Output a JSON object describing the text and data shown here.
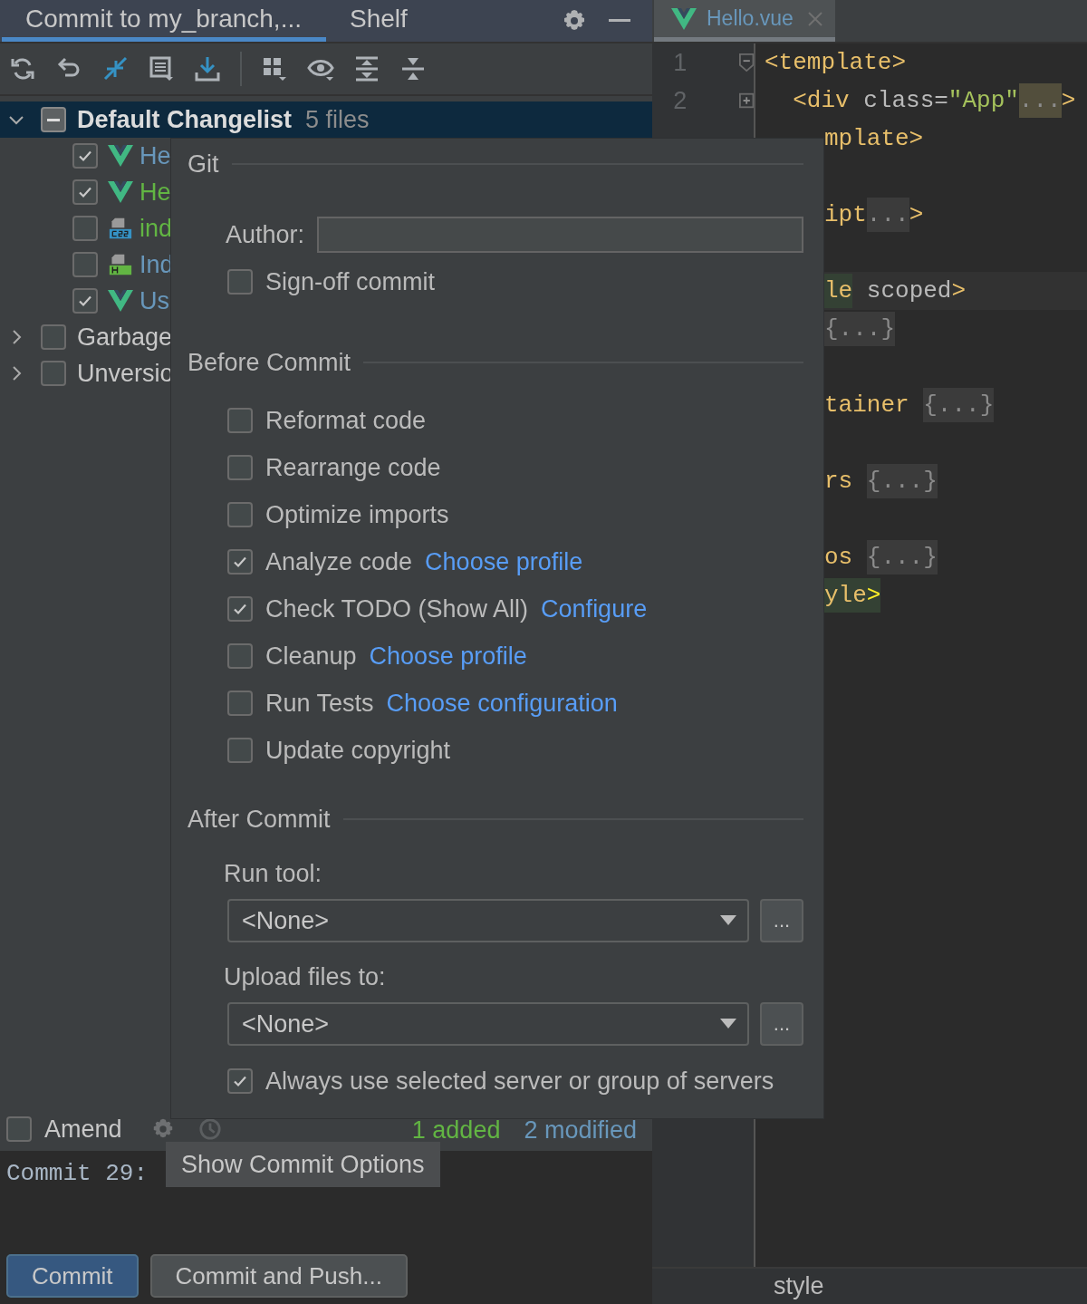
{
  "tool_window": {
    "tabs": [
      {
        "label": "Commit to my_branch,...",
        "selected": true
      },
      {
        "label": "Shelf",
        "selected": false
      }
    ]
  },
  "changes_tree": {
    "changelist": {
      "name": "Default Changelist",
      "count": "5 files",
      "expanded": true,
      "selected": true,
      "mixed": true,
      "files": [
        {
          "name": "He",
          "kind": "vue",
          "color": "#6897bb",
          "checked": true
        },
        {
          "name": "He",
          "kind": "vue",
          "color": "#62b543",
          "checked": true
        },
        {
          "name": "ind",
          "kind": "css",
          "color": "#62b543",
          "checked": false
        },
        {
          "name": "Ind",
          "kind": "html",
          "color": "#6897bb",
          "checked": false
        },
        {
          "name": "Us",
          "kind": "vue",
          "color": "#6897bb",
          "checked": true
        }
      ]
    },
    "groups": [
      {
        "name": "Garbage",
        "expanded": false,
        "checked": false
      },
      {
        "name": "Unversio",
        "expanded": false,
        "checked": false
      }
    ]
  },
  "commit_bar": {
    "amend": {
      "label": "Amend",
      "checked": false
    },
    "added": "1 added",
    "modified": "2 modified"
  },
  "message": "Commit 29:",
  "buttons": [
    {
      "label": "Commit",
      "kind": "primary"
    },
    {
      "label": "Commit and Push...",
      "kind": "secondary"
    }
  ],
  "editor": {
    "tab": {
      "label": "Hello.vue",
      "selected": true
    },
    "lines": [
      {
        "kind": "code",
        "number": "1",
        "folded": false,
        "segments": [
          {
            "text": "<template>",
            "kind": "tag"
          }
        ]
      },
      {
        "kind": "code",
        "number": "2",
        "folded": true,
        "segments": [
          {
            "text": "  <div",
            "kind": "tag"
          },
          {
            "text": " class=",
            "kind": "attr"
          },
          {
            "text": "\"App\"",
            "kind": "string"
          },
          {
            "text": "...",
            "kind": "fold_mark"
          },
          {
            "text": ">",
            "kind": "tag"
          }
        ]
      },
      {
        "kind": "code",
        "cut": true,
        "segments": [
          {
            "text": "mplate>",
            "kind": "tag"
          }
        ]
      },
      {
        "kind": "blank"
      },
      {
        "kind": "code",
        "cut": true,
        "segments": [
          {
            "text": "ipt",
            "kind": "tag"
          },
          {
            "text": "...",
            "kind": "fold"
          },
          {
            "text": ">",
            "kind": "tag"
          }
        ]
      },
      {
        "kind": "blank"
      },
      {
        "kind": "code",
        "cut": true,
        "current": true,
        "segments": [
          {
            "text": "le",
            "kind": "matched"
          },
          {
            "text": " scoped",
            "kind": "attr"
          },
          {
            "text": ">",
            "kind": "tag"
          }
        ]
      },
      {
        "kind": "code",
        "cut": true,
        "segments": [
          {
            "text": "{...}",
            "kind": "fold"
          }
        ]
      },
      {
        "kind": "blank"
      },
      {
        "kind": "code",
        "cut": true,
        "segments": [
          {
            "text": "tainer ",
            "kind": "tag"
          },
          {
            "text": "{...}",
            "kind": "fold"
          }
        ]
      },
      {
        "kind": "blank"
      },
      {
        "kind": "code",
        "cut": true,
        "segments": [
          {
            "text": "rs ",
            "kind": "tag"
          },
          {
            "text": "{...}",
            "kind": "fold"
          }
        ]
      },
      {
        "kind": "blank"
      },
      {
        "kind": "code",
        "cut": true,
        "segments": [
          {
            "text": "os ",
            "kind": "tag"
          },
          {
            "text": "{...}",
            "kind": "fold"
          }
        ]
      },
      {
        "kind": "code",
        "cut": true,
        "segments": [
          {
            "text": "yle",
            "kind": "matched"
          },
          {
            "text": ">",
            "kind": "matched_bright"
          }
        ]
      }
    ],
    "breadcrumb": "style"
  },
  "commit_options": {
    "sections": [
      {
        "title": "Git",
        "items": [
          {
            "kind": "field",
            "label": "Author:"
          },
          {
            "kind": "checkbox",
            "label": "Sign-off commit",
            "checked": false
          }
        ]
      },
      {
        "title": "Before Commit",
        "items": [
          {
            "kind": "checkbox",
            "label": "Reformat code",
            "checked": false
          },
          {
            "kind": "checkbox",
            "label": "Rearrange code",
            "checked": false
          },
          {
            "kind": "checkbox",
            "label": "Optimize imports",
            "checked": false
          },
          {
            "kind": "checkbox",
            "label": "Analyze code",
            "checked": true,
            "link": "Choose profile"
          },
          {
            "kind": "checkbox",
            "label": "Check TODO (Show All)",
            "checked": true,
            "link": "Configure"
          },
          {
            "kind": "checkbox",
            "label": "Cleanup",
            "checked": false,
            "link": "Choose profile"
          },
          {
            "kind": "checkbox",
            "label": "Run Tests",
            "checked": false,
            "link": "Choose configuration"
          },
          {
            "kind": "checkbox",
            "label": "Update copyright",
            "checked": false
          }
        ]
      },
      {
        "title": "After Commit",
        "items": [
          {
            "kind": "dropdown",
            "label": "Run tool:",
            "value": "<None>",
            "button": "..."
          },
          {
            "kind": "dropdown",
            "label": "Upload files to:",
            "value": "<None>",
            "button": "..."
          },
          {
            "kind": "checkbox",
            "label": "Always use selected server or group of servers",
            "checked": true
          }
        ]
      }
    ]
  },
  "tooltip": "Show Commit Options"
}
